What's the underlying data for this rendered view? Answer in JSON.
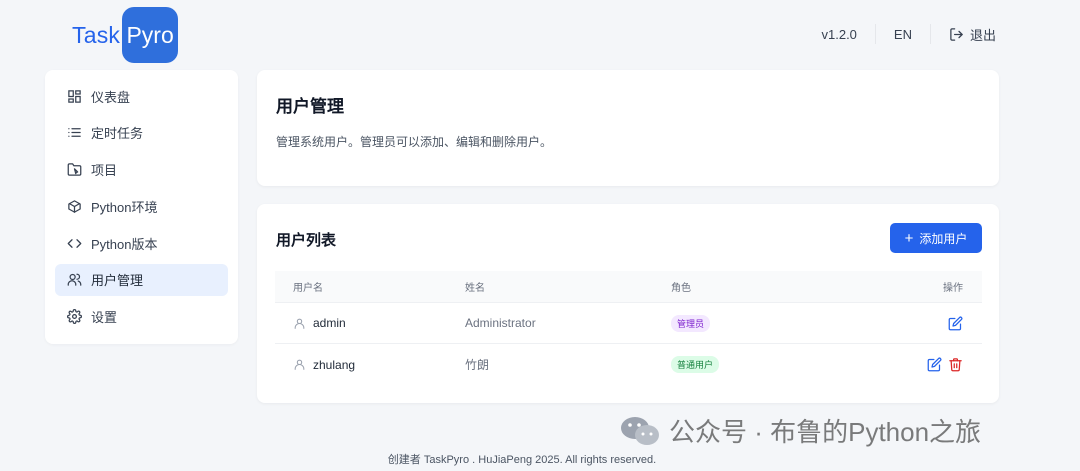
{
  "logo": {
    "part1": "Task",
    "part2": "Pyro"
  },
  "topbar": {
    "version": "v1.2.0",
    "language": "EN",
    "logout": "退出"
  },
  "sidebar": {
    "items": [
      {
        "label": "仪表盘",
        "icon": "dashboard-icon"
      },
      {
        "label": "定时任务",
        "icon": "list-icon"
      },
      {
        "label": "项目",
        "icon": "folder-icon"
      },
      {
        "label": "Python环境",
        "icon": "cube-icon"
      },
      {
        "label": "Python版本",
        "icon": "code-icon"
      },
      {
        "label": "用户管理",
        "icon": "users-icon",
        "active": true
      },
      {
        "label": "设置",
        "icon": "gear-icon"
      }
    ]
  },
  "page": {
    "title": "用户管理",
    "description": "管理系统用户。管理员可以添加、编辑和删除用户。"
  },
  "user_list": {
    "title": "用户列表",
    "add_button": "添加用户",
    "columns": [
      "用户名",
      "姓名",
      "角色",
      "操作"
    ],
    "rows": [
      {
        "username": "admin",
        "name": "Administrator",
        "role": "管理员",
        "role_type": "admin",
        "actions": [
          "edit"
        ]
      },
      {
        "username": "zhulang",
        "name": "竹朗",
        "role": "普通用户",
        "role_type": "user",
        "actions": [
          "edit",
          "delete"
        ]
      }
    ]
  },
  "footer": "创建者 TaskPyro . HuJiaPeng 2025. All rights reserved.",
  "watermark": "公众号 · 布鲁的Python之旅",
  "colors": {
    "primary": "#2563eb",
    "danger": "#dc2626",
    "admin_badge": "#7e22ce",
    "user_badge": "#15803d"
  }
}
